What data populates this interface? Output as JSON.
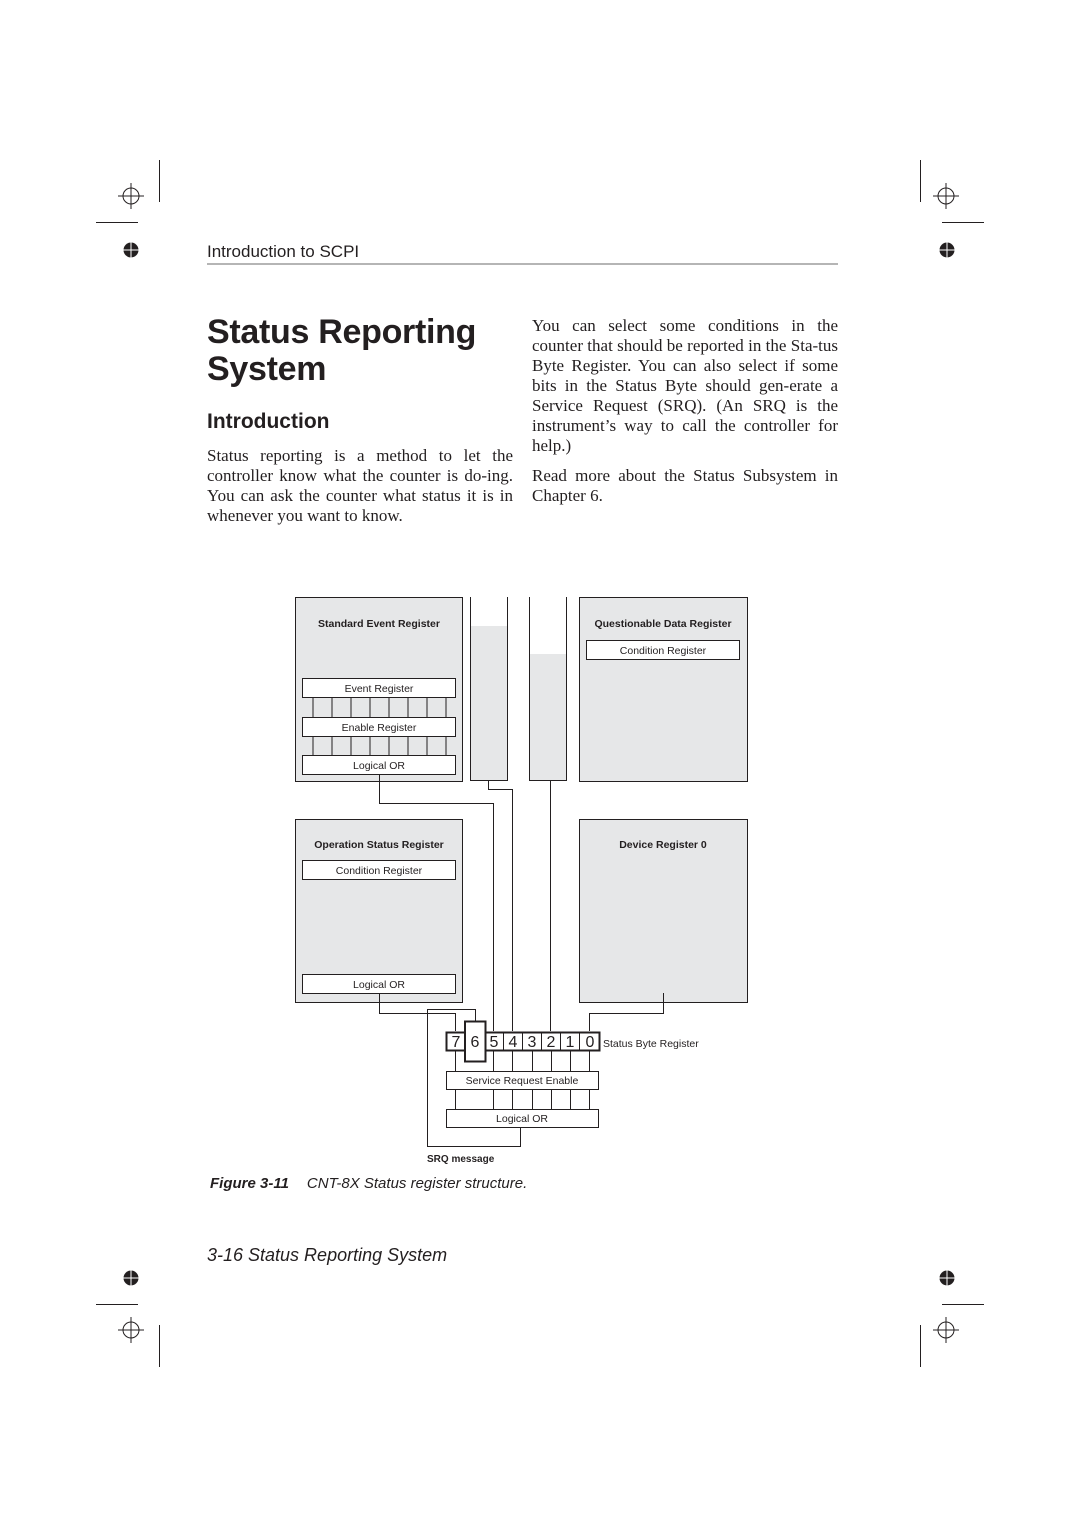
{
  "running_head": "Introduction to SCPI",
  "title_line1": "Status Reporting",
  "title_line2": "System",
  "section_heading": "Introduction",
  "paragraphs": [
    "Status reporting is a method to let the controller know what the counter is do-ing. You can ask the counter what status it is in whenever you want to know.",
    "You can select some conditions in the counter that should be reported in the Sta-tus Byte Register. You can also select if some bits in the Status Byte should gen-erate a Service Request (SRQ). (An SRQ is the instrument’s way to call the controller for help.)",
    "Read more about the Status Subsystem in Chapter 6."
  ],
  "diagram": {
    "standard_event_register": {
      "title": "Standard Event Register",
      "event_register": "Event Register",
      "enable_register": "Enable Register",
      "logical_or": "Logical OR"
    },
    "questionable_data_register": {
      "title": "Questionable Data Register",
      "condition_register": "Condition Register"
    },
    "operation_status_register": {
      "title": "Operation Status Register",
      "condition_register": "Condition Register",
      "logical_or": "Logical OR"
    },
    "device_register": {
      "title": "Device Register 0"
    },
    "status_byte": {
      "label": "Status Byte Register",
      "bits": [
        "7",
        "6",
        "5",
        "4",
        "3",
        "2",
        "1",
        "0"
      ]
    },
    "service_request_enable": "Service Request Enable",
    "srq_logical_or": "Logical OR",
    "srq_message": "SRQ message"
  },
  "caption": {
    "figure_label": "Figure 3-11",
    "text": "CNT-8X Status register structure."
  },
  "footer": "3-16 Status Reporting System",
  "colors": {
    "box_fill": "#e6e7e8",
    "line": "#231f20",
    "rule": "#b5b5b5"
  }
}
